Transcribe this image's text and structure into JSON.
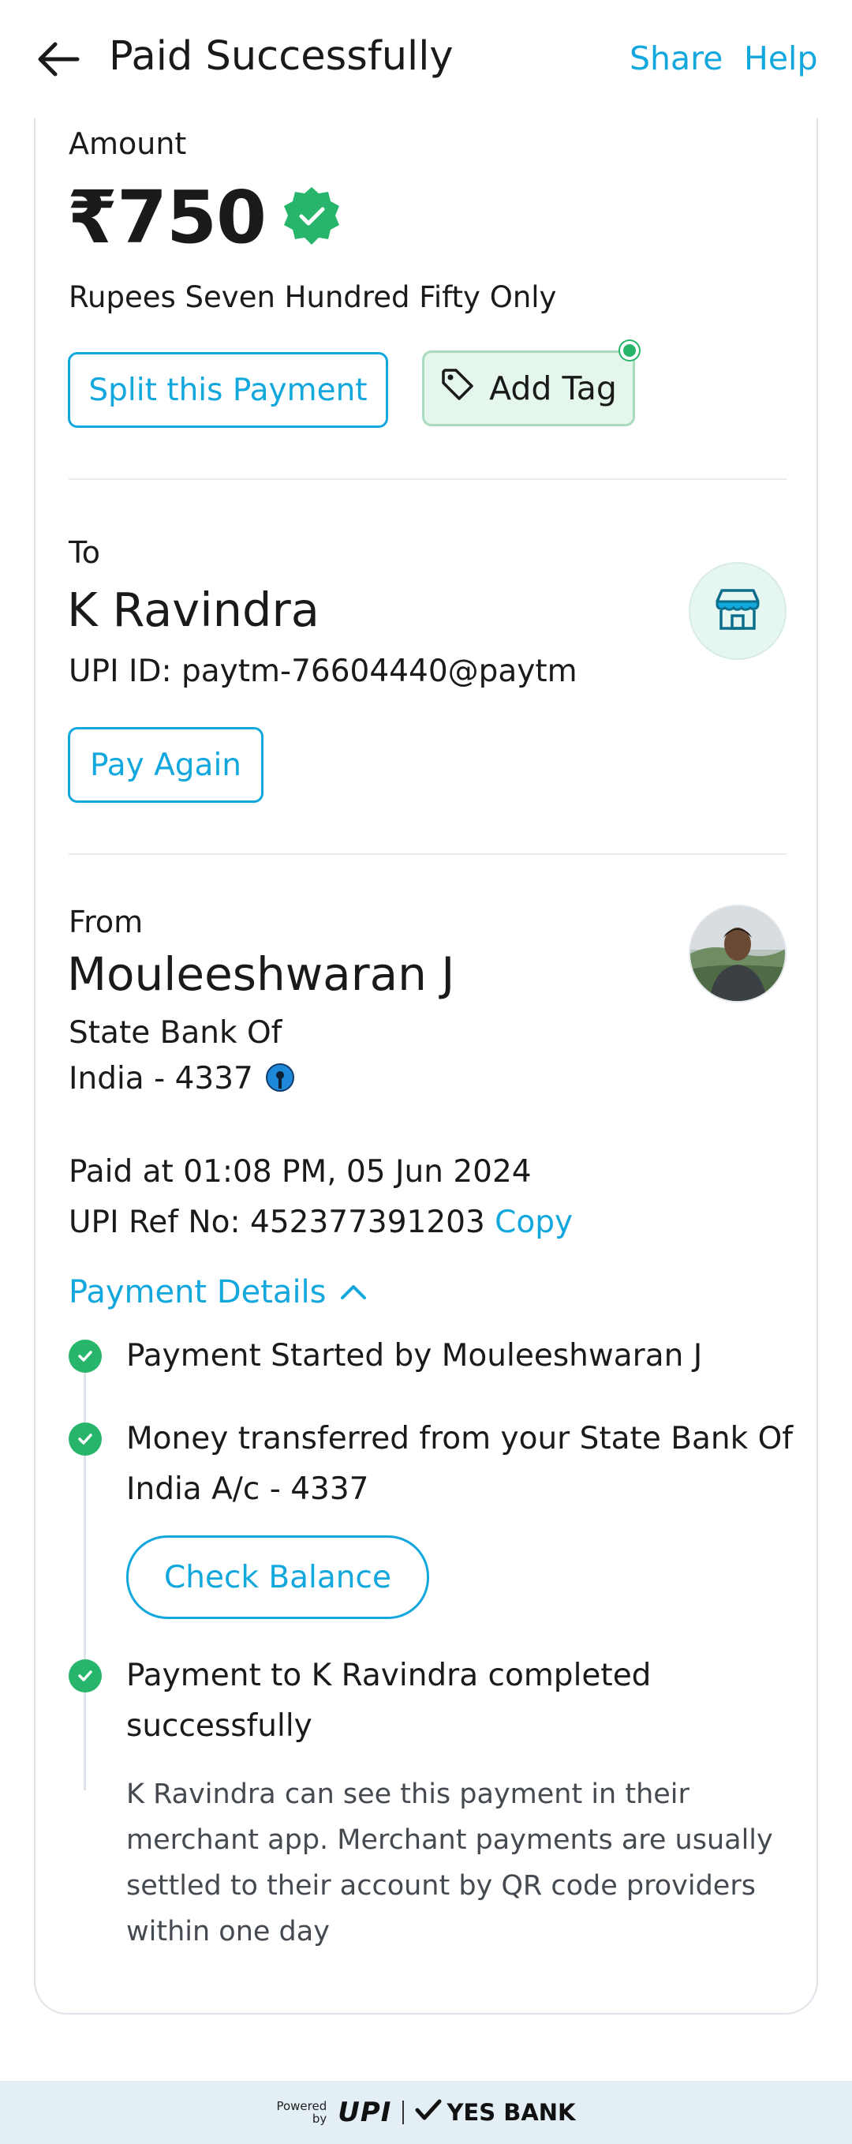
{
  "header": {
    "title": "Paid Successfully",
    "share_label": "Share",
    "help_label": "Help"
  },
  "amount_section": {
    "label": "Amount",
    "amount": "₹750",
    "amount_words": "Rupees Seven Hundred Fifty Only",
    "split_label": "Split this Payment",
    "tag_label": "Add Tag"
  },
  "to_section": {
    "label": "To",
    "name": "K Ravindra",
    "upi_id": "UPI ID: paytm-76604440@paytm",
    "pay_again_label": "Pay Again",
    "icon": "store-icon"
  },
  "from_section": {
    "label": "From",
    "name": "Mouleeshwaran J",
    "bank_line1": "State Bank Of",
    "bank_line2": "India - 4337",
    "bank_icon": "sbi-logo-icon"
  },
  "transaction": {
    "paid_at": "Paid at 01:08 PM, 05 Jun 2024",
    "ref_prefix": "UPI Ref No: 452377391203",
    "copy_label": "Copy"
  },
  "payment_details": {
    "label": "Payment Details",
    "steps": [
      {
        "text": "Payment Started by Mouleeshwaran J"
      },
      {
        "text": "Money transferred from your State Bank Of India A/c - 4337",
        "button": "Check Balance"
      },
      {
        "text": "Payment to K Ravindra completed successfully",
        "note": "K Ravindra can see this payment in their merchant app. Merchant payments are usually settled to their account by QR code providers within one day"
      }
    ]
  },
  "footer": {
    "powered_line1": "Powered",
    "powered_line2": "by",
    "upi_logo": "UPI",
    "bank_name": "YES BANK"
  },
  "colors": {
    "accent": "#12a7dd",
    "success": "#26b56a",
    "footer_bg": "#e3eef5"
  }
}
